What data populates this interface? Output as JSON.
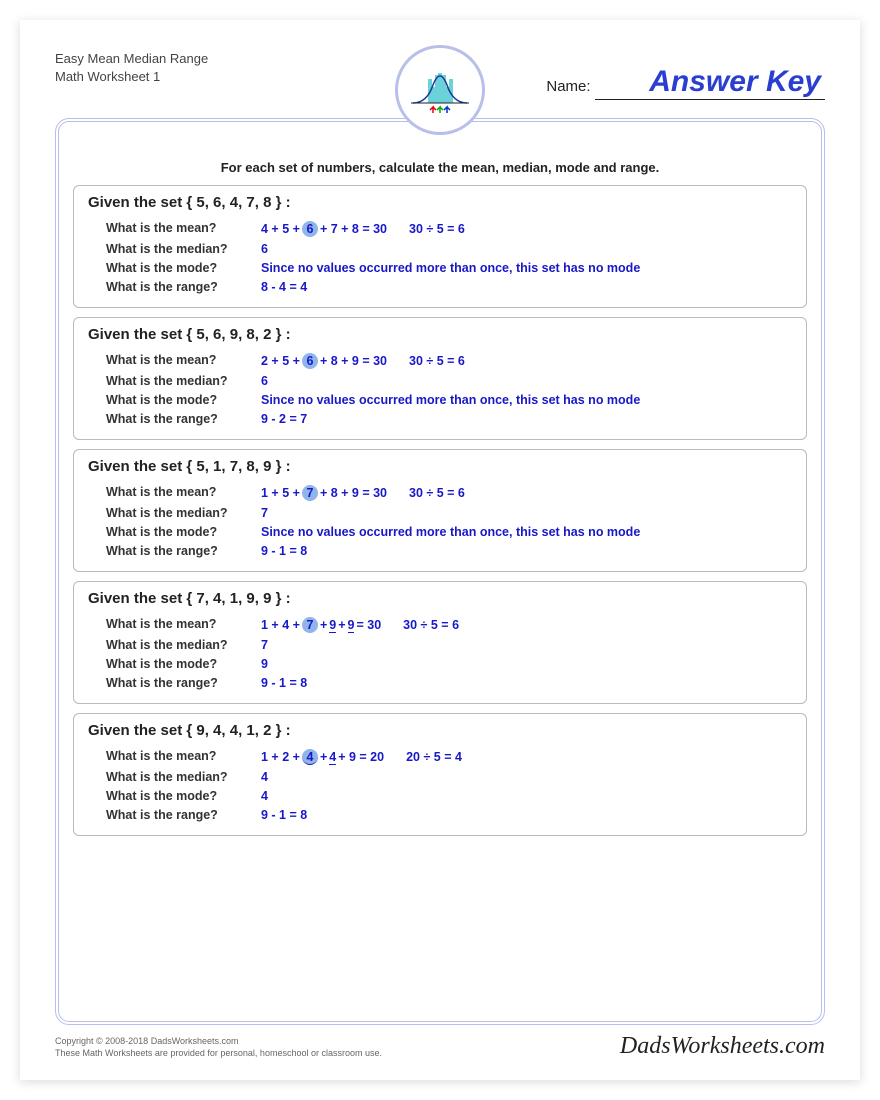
{
  "header": {
    "title_line1": "Easy Mean Median Range",
    "title_line2": "Math Worksheet 1",
    "name_label": "Name:",
    "answer_key": "Answer Key"
  },
  "instruction": "For each set of numbers, calculate the mean, median, mode and range.",
  "labels": {
    "mean": "What is the mean?",
    "median": "What is the median?",
    "mode": "What is the mode?",
    "range": "What is the range?"
  },
  "problems": [
    {
      "title": "Given the set { 5, 6, 4, 7, 8 } :",
      "mean": {
        "pre": "4 + 5 + ",
        "hl": "6",
        "post": " + 7 + 8 = 30",
        "div": "30 ÷ 5 = 6"
      },
      "median": "6",
      "mode": "Since no values occurred more than once, this set has no mode",
      "range": "8 - 4 = 4"
    },
    {
      "title": "Given the set { 5, 6, 9, 8, 2 } :",
      "mean": {
        "pre": "2 + 5 + ",
        "hl": "6",
        "post": " + 8 + 9 = 30",
        "div": "30 ÷ 5 = 6"
      },
      "median": "6",
      "mode": "Since no values occurred more than once, this set has no mode",
      "range": "9 - 2 = 7"
    },
    {
      "title": "Given the set { 5, 1, 7, 8, 9 } :",
      "mean": {
        "pre": "1 + 5 + ",
        "hl": "7",
        "post": " + 8 + 9 = 30",
        "div": "30 ÷ 5 = 6"
      },
      "median": "7",
      "mode": "Since no values occurred more than once, this set has no mode",
      "range": "9 - 1 = 8"
    },
    {
      "title": "Given the set { 7, 4, 1, 9, 9 } :",
      "mean": {
        "pre": "1 + 4 + ",
        "hl": "7",
        "post1": " + ",
        "ul1": "9",
        "post2": " + ",
        "ul2": "9",
        "post3": " = 30",
        "div": "30 ÷ 5 = 6"
      },
      "median": "7",
      "mode": "9",
      "range": "9 - 1 = 8"
    },
    {
      "title": "Given the set { 9, 4, 4, 1, 2 } :",
      "mean": {
        "pre": "1 + 2 + ",
        "hl": "4",
        "ulhl": true,
        "post1": " + ",
        "ul1": "4",
        "post3": " + 9 = 20",
        "div": "20 ÷ 5 = 4"
      },
      "median": "4",
      "mode": "4",
      "range": "9 - 1 = 8"
    }
  ],
  "footer": {
    "copyright": "Copyright © 2008-2018 DadsWorksheets.com",
    "disclaimer": "These Math Worksheets are provided for personal, homeschool or classroom use.",
    "brand": "DadsWorksheets.com"
  }
}
